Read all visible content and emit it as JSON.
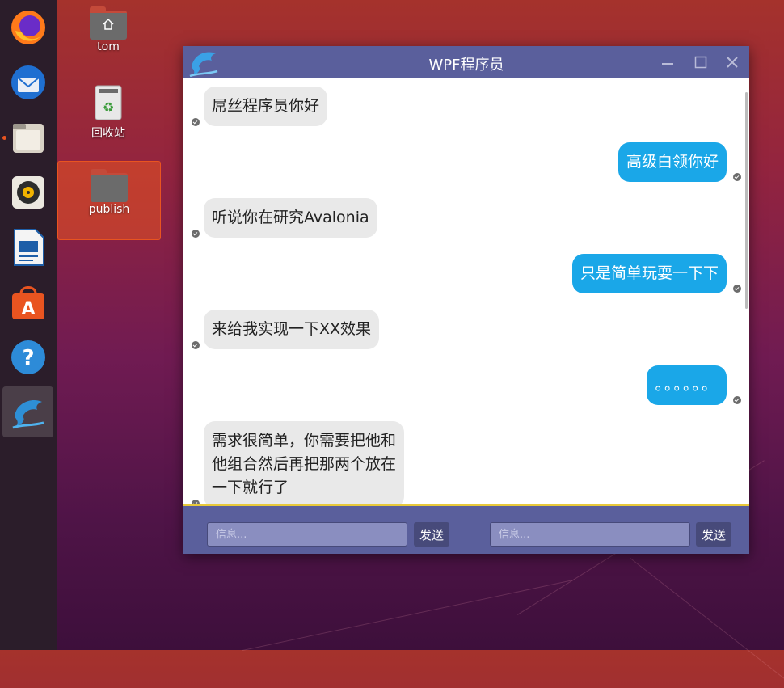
{
  "desktop": {
    "icons": [
      {
        "label": "tom"
      },
      {
        "label": "回收站"
      },
      {
        "label": "publish"
      }
    ]
  },
  "dock": {
    "items": [
      {
        "icon": "firefox-icon"
      },
      {
        "icon": "thunderbird-icon"
      },
      {
        "icon": "files-icon"
      },
      {
        "icon": "rhythmbox-icon"
      },
      {
        "icon": "writer-icon"
      },
      {
        "icon": "software-icon"
      },
      {
        "icon": "help-icon"
      },
      {
        "icon": "dolphin-app-icon"
      }
    ]
  },
  "window": {
    "title": "WPF程序员",
    "messages": [
      {
        "side": "left",
        "text": "屌丝程序员你好"
      },
      {
        "side": "right",
        "text": "高级白领你好"
      },
      {
        "side": "left",
        "text": "听说你在研究Avalonia"
      },
      {
        "side": "right",
        "text": "只是简单玩耍一下下"
      },
      {
        "side": "left",
        "text": "来给我实现一下XX效果"
      },
      {
        "side": "right",
        "text": "。。。。。。"
      },
      {
        "side": "left",
        "text": "需求很简单，你需要把他和他组合然后再把那两个放在一下就行了"
      }
    ],
    "message_lines": {
      "last": [
        "需求很简单，你需要把他和",
        "他组合然后再把那两个放在",
        "一下就行了"
      ]
    },
    "input_left": {
      "placeholder": "信息..."
    },
    "input_right": {
      "placeholder": "信息..."
    },
    "send_label": "发送"
  },
  "colors": {
    "titlebar": "#5a5f9c",
    "bubble_right": "#1aa7e8",
    "bubble_left": "#e9e9e9",
    "accent": "#e95420"
  }
}
